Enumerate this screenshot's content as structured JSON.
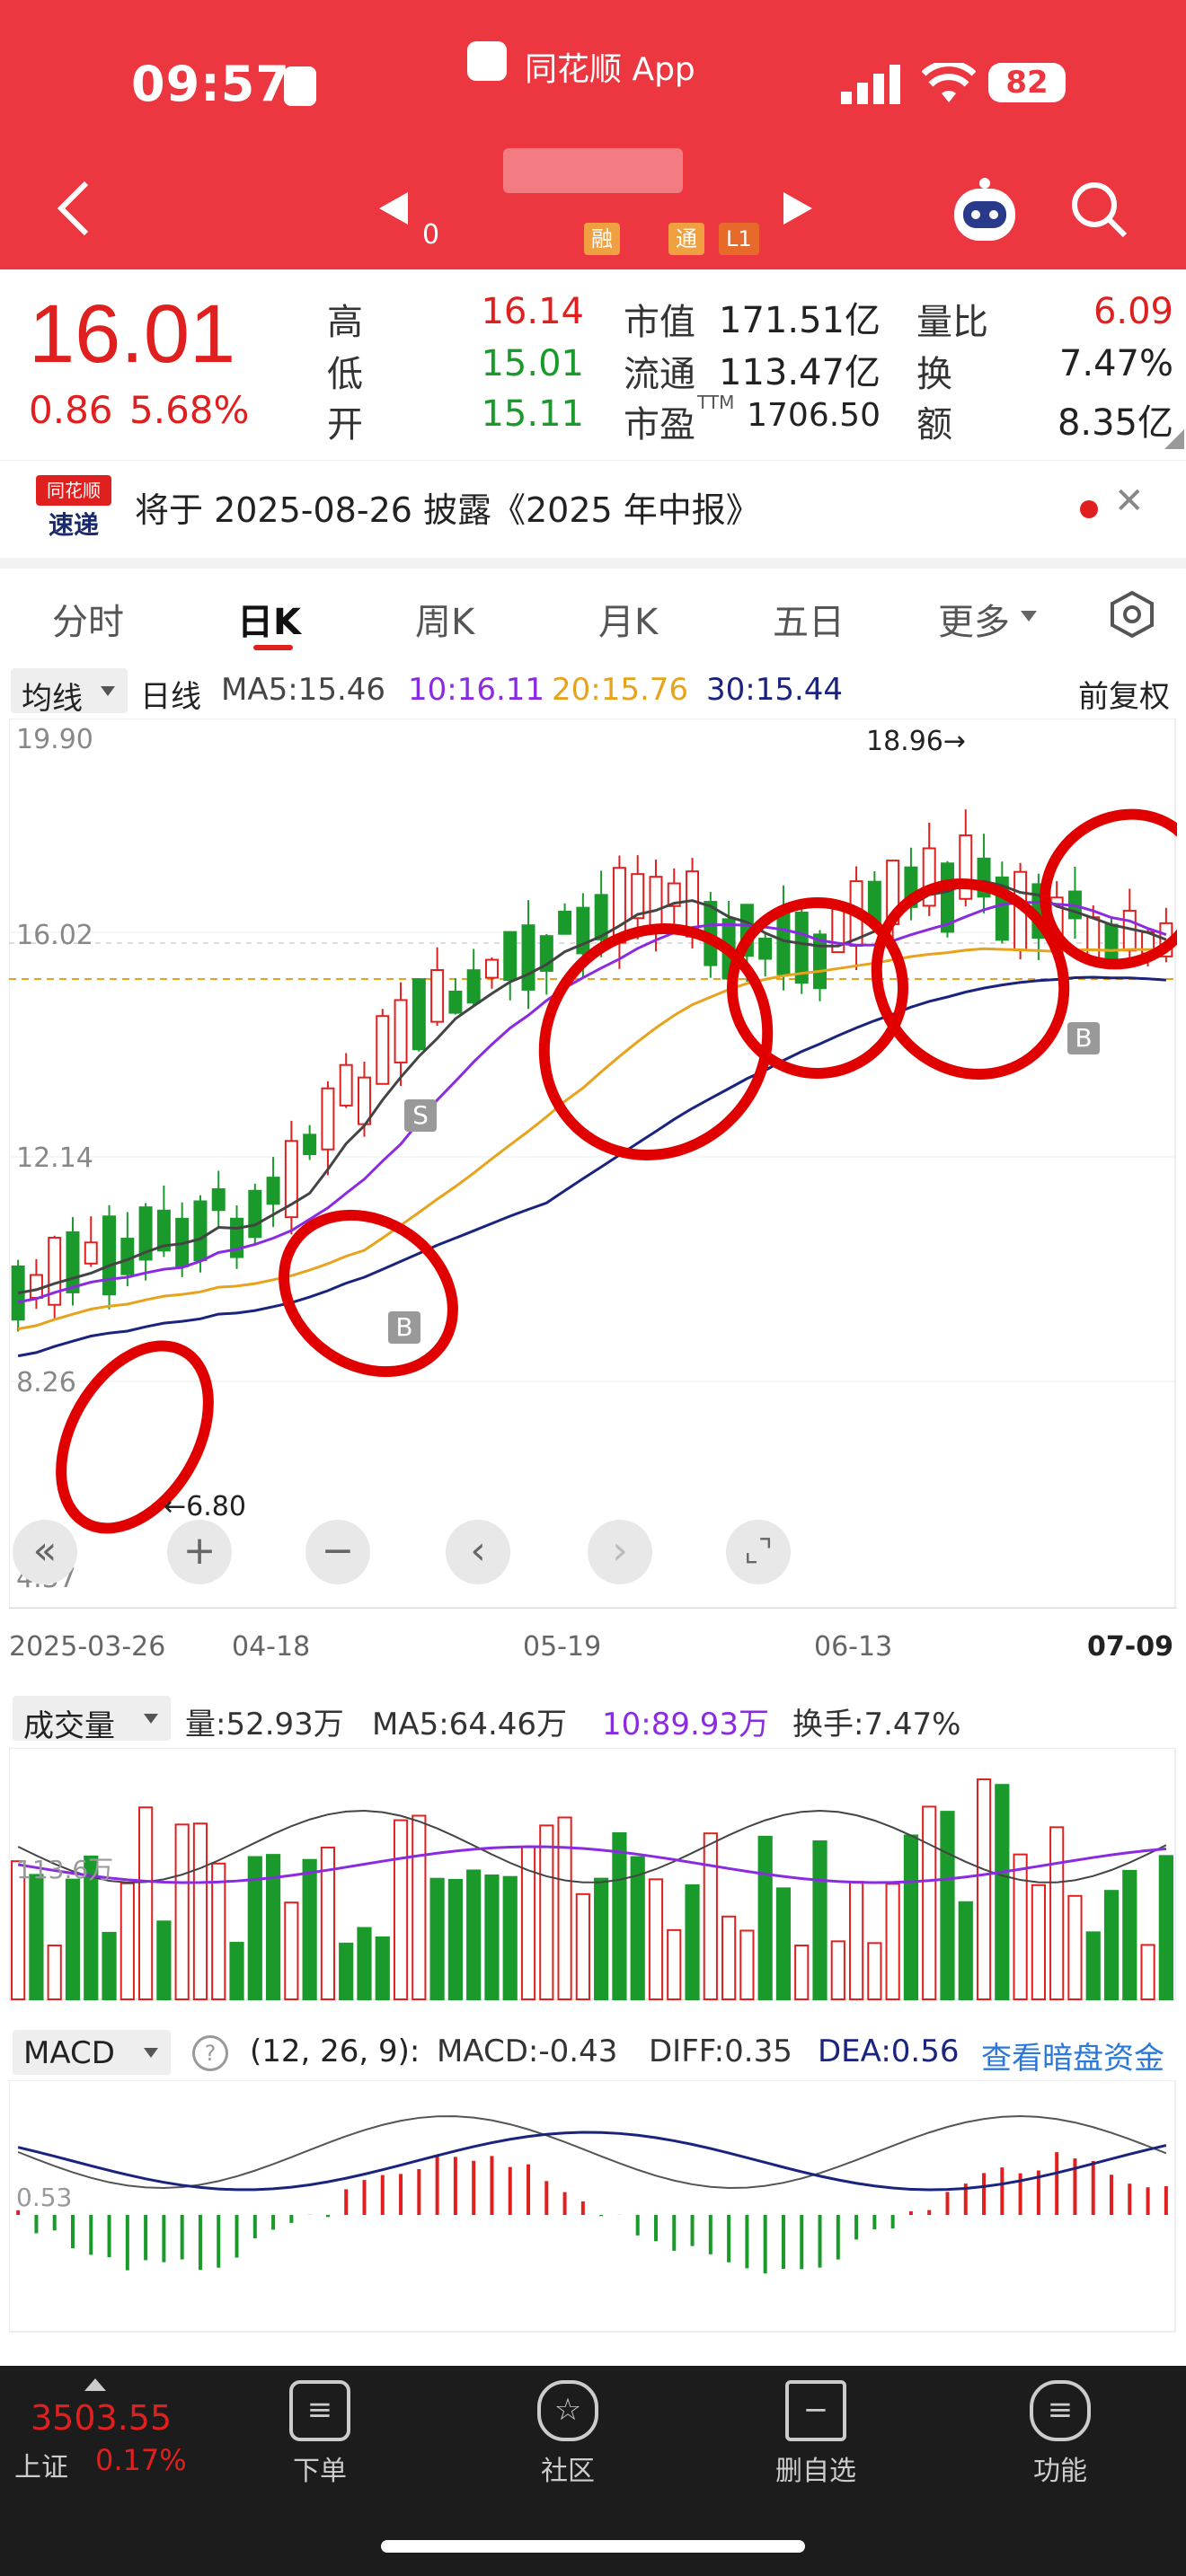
{
  "status_bar": {
    "time": "09:57",
    "app_label": "同花顺 App",
    "battery": "82"
  },
  "nav": {
    "code_fragment": "0",
    "tags": [
      "融",
      "通",
      "L1"
    ]
  },
  "quote": {
    "price": "16.01",
    "change": "0.86",
    "change_pct": "5.68%",
    "high_label": "高",
    "high": "16.14",
    "low_label": "低",
    "low": "15.01",
    "open_label": "开",
    "open": "15.11",
    "mktcap_label": "市值",
    "mktcap": "171.51亿",
    "float_label": "流通",
    "float": "113.47亿",
    "pe_label": "市盈",
    "pe_sup": "TTM",
    "pe": "1706.50",
    "volratio_label": "量比",
    "volratio": "6.09",
    "turnover_label": "换",
    "turnover": "7.47%",
    "amount_label": "额",
    "amount": "8.35亿"
  },
  "notice": {
    "badge_top": "同花顺",
    "badge_bottom": "速递",
    "text": "将于 2025-08-26 披露《2025 年中报》"
  },
  "tabs": [
    "分时",
    "日K",
    "周K",
    "月K",
    "五日",
    "更多"
  ],
  "active_tab": 1,
  "kline": {
    "ma_selector": "均线",
    "period": "日线",
    "ma5": "MA5:15.46",
    "ma10": "10:16.11",
    "ma20": "20:15.76",
    "ma30": "30:15.44",
    "adjust": "前复权",
    "y_labels": [
      "19.90",
      "16.02",
      "12.14",
      "8.26",
      "4.37"
    ],
    "high_marker": "18.96→",
    "low_marker": "←6.80",
    "dates": [
      "2025-03-26",
      "04-18",
      "05-19",
      "06-13",
      "07-09"
    ],
    "markers": {
      "sell": "S",
      "buy1": "B",
      "buy2": "B"
    }
  },
  "volume": {
    "selector": "成交量",
    "vol": "量:52.93万",
    "ma5": "MA5:64.46万",
    "ma10": "10:89.93万",
    "turnover": "换手:7.47%",
    "y_label": "113.6万"
  },
  "macd": {
    "selector": "MACD",
    "params": "(12, 26, 9):",
    "macd": "MACD:-0.43",
    "diff": "DIFF:0.35",
    "dea": "DEA:0.56",
    "link": "查看暗盘资金",
    "y_label": "0.53"
  },
  "bottom": {
    "index_value": "3503.55",
    "index_name": "上证",
    "index_pct": "0.17%",
    "items": [
      "下单",
      "社区",
      "删自选",
      "功能"
    ]
  },
  "colors": {
    "brand": "#ec3640",
    "up": "#e0201e",
    "down": "#1a9a2a",
    "ma5": "#444444",
    "ma10": "#8a2be2",
    "ma20": "#e8a31c",
    "ma30": "#1a237e",
    "annot": "#e00000"
  }
}
